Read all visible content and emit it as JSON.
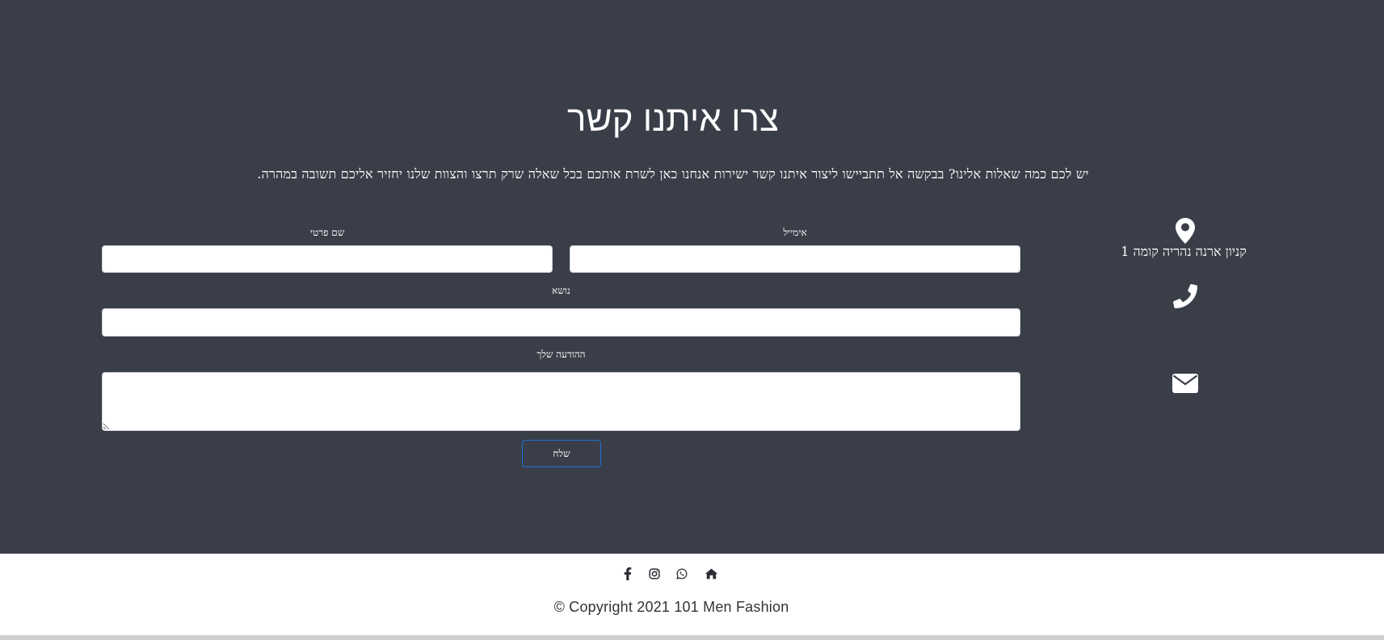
{
  "contact": {
    "title": "צרו איתנו קשר",
    "subtitle": "יש לכם כמה שאלות אלינו? בבקשה אל תתביישו ליצור איתנו קשר ישירות אנחנו כאן לשרת אותכם בכל שאלה שרק תרצו והצוות שלנו יחזיר אליכם תשובה במהרה."
  },
  "form": {
    "email_label": "אימייל",
    "email_value": "",
    "first_name_label": "שם פרטי",
    "first_name_value": "",
    "subject_label": "נושא",
    "subject_value": "",
    "message_label": "ההודעה שלך",
    "message_value": "",
    "submit_label": "שלח"
  },
  "info": {
    "address": "קניון ארנה נהריה קומה 1",
    "icons": [
      "map-marker-icon",
      "phone-icon",
      "envelope-icon"
    ]
  },
  "footer": {
    "social_icons": [
      "facebook-icon",
      "instagram-icon",
      "whatsapp-icon",
      "home-icon"
    ],
    "copyright": "© Copyright 2021 101 Men Fashion"
  },
  "colors": {
    "background": "#3a3e48",
    "footer_background": "#ffffff",
    "button_border": "#1f6fd6",
    "text": "#ffffff",
    "footer_text": "#333333"
  }
}
